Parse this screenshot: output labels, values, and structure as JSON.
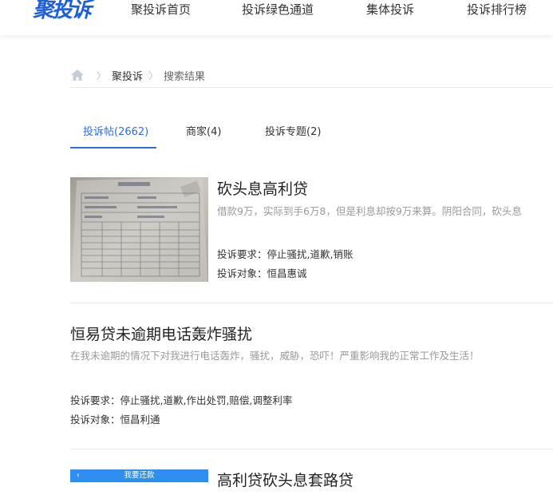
{
  "header": {
    "logo_text": "聚投诉",
    "nav": [
      "聚投诉首页",
      "投诉绿色通道",
      "集体投诉",
      "投诉排行榜"
    ]
  },
  "breadcrumb": {
    "home_icon": "home-icon",
    "site": "聚投诉",
    "current": "搜索结果"
  },
  "tabs": [
    {
      "label": "投诉帖(2662)",
      "active": true
    },
    {
      "label": "商家(4)",
      "active": false
    },
    {
      "label": "投诉专题(2)",
      "active": false
    }
  ],
  "results": [
    {
      "title": "砍头息高利贷",
      "desc": "借款9万，实际到手6万8，但是利息却按9万来算。阴阳合同，砍头息",
      "demand_label": "投诉要求：",
      "demand": "停止骚扰,道歉,销账",
      "target_label": "投诉对象：",
      "target": "恒昌惠诚",
      "thumbnail": "document-photo"
    },
    {
      "title": "恒易贷未逾期电话轰炸骚扰",
      "desc": "在我未逾期的情况下对我进行电话轰炸，骚扰，威胁，恐吓！严重影响我的正常工作及生活！",
      "demand_label": "投诉要求：",
      "demand": "停止骚扰,道歉,作出处罚,赔偿,调整利率",
      "target_label": "投诉对象：",
      "target": "恒昌利通"
    },
    {
      "title": "高利贷砍头息套路贷",
      "thumbnail_bar_text": "我要还款",
      "thumbnail_back": "‹"
    }
  ],
  "colors": {
    "brand": "#1e5fd4",
    "tab_active": "#2d6fd6",
    "desc_gray": "#9a9a9a",
    "thumb_bar": "#2f8ff0"
  }
}
